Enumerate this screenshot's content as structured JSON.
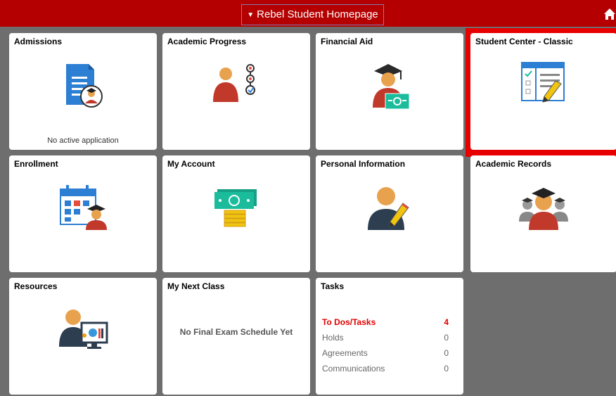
{
  "header": {
    "title": "Rebel Student Homepage",
    "caret": "▼"
  },
  "tiles": {
    "admissions": {
      "title": "Admissions",
      "subtitle": "No active application"
    },
    "academic_progress": {
      "title": "Academic Progress"
    },
    "financial_aid": {
      "title": "Financial Aid"
    },
    "student_center": {
      "title": "Student Center - Classic"
    },
    "enrollment": {
      "title": "Enrollment"
    },
    "my_account": {
      "title": "My Account"
    },
    "personal_information": {
      "title": "Personal Information"
    },
    "academic_records": {
      "title": "Academic Records"
    },
    "resources": {
      "title": "Resources"
    },
    "my_next_class": {
      "title": "My Next Class",
      "message": "No Final Exam Schedule Yet"
    },
    "tasks": {
      "title": "Tasks",
      "items": [
        {
          "label": "To Dos/Tasks",
          "count": "4"
        },
        {
          "label": "Holds",
          "count": "0"
        },
        {
          "label": "Agreements",
          "count": "0"
        },
        {
          "label": "Communications",
          "count": "0"
        }
      ]
    }
  },
  "colors": {
    "header": "#b40000",
    "highlight": "#e60000",
    "background": "#6e6e6e"
  },
  "icons": [
    "home-icon",
    "document-graduate-icon",
    "progress-person-icon",
    "graduate-money-icon",
    "classic-form-icon",
    "calendar-graduate-icon",
    "money-coins-icon",
    "person-edit-icon",
    "graduates-group-icon",
    "person-computer-icon"
  ]
}
